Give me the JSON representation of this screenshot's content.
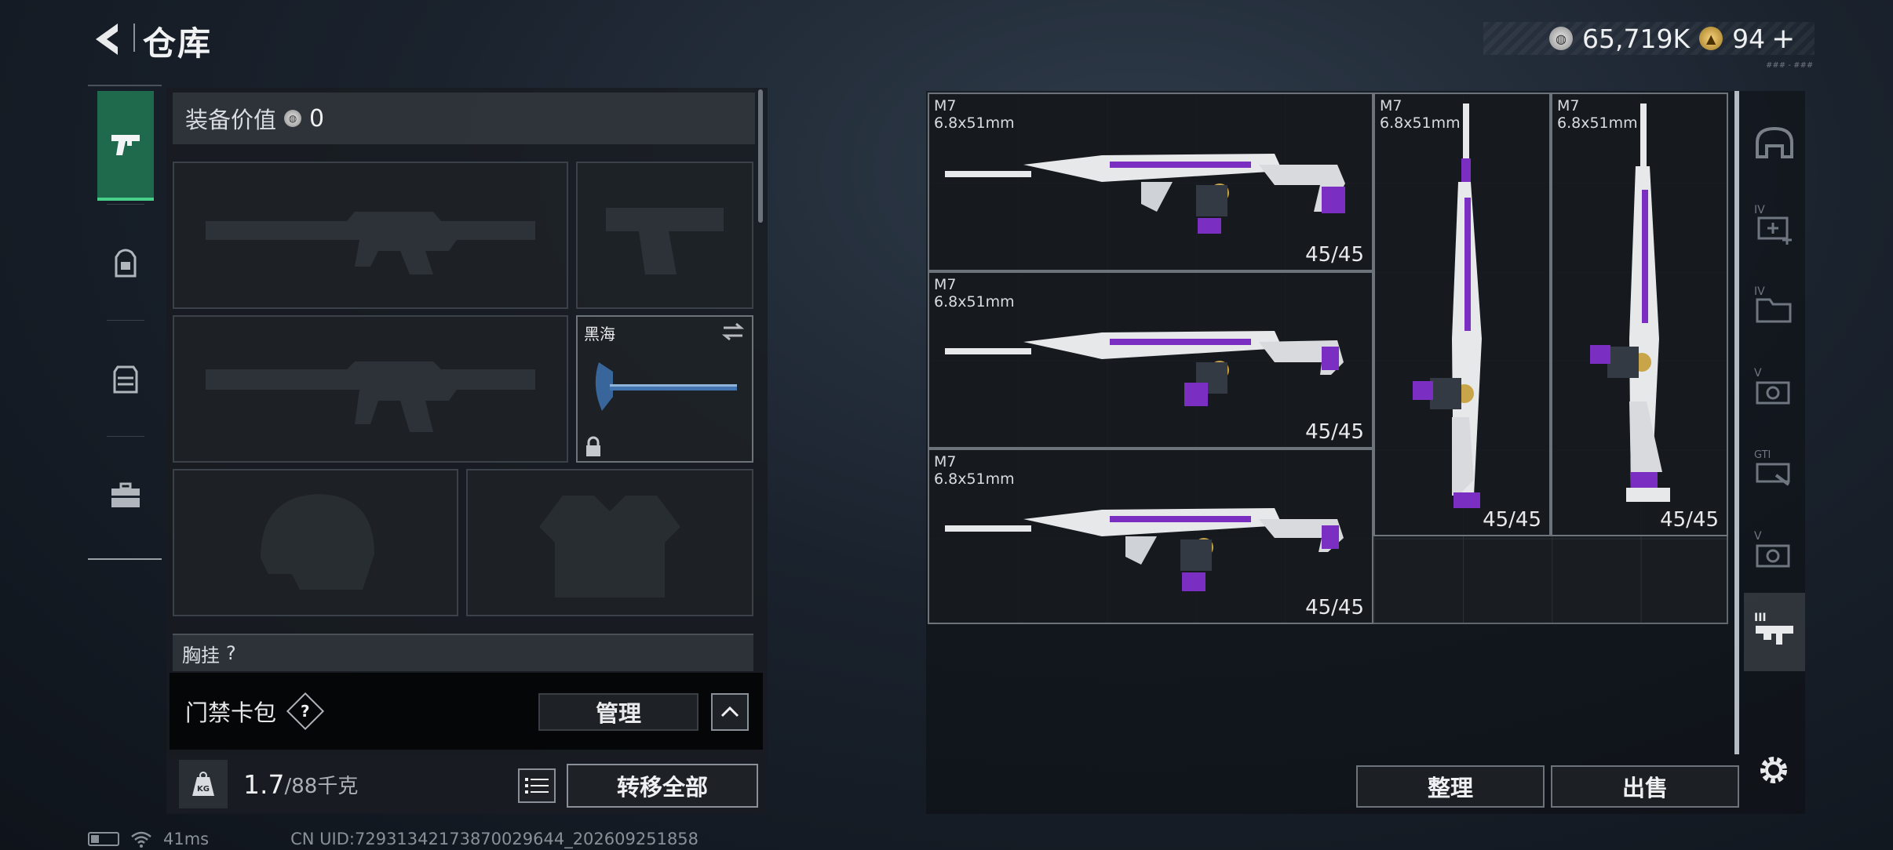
{
  "header": {
    "title": "仓库",
    "currency": {
      "silver": "65,719K",
      "gold": "94",
      "plus": "+"
    },
    "tiny_code": "### - ###"
  },
  "left_nav": {
    "items": [
      {
        "name": "weapons",
        "icon": "pistol-icon",
        "active": true
      },
      {
        "name": "backpack",
        "icon": "backpack-icon",
        "active": false
      },
      {
        "name": "vest",
        "icon": "vest-icon",
        "active": false
      },
      {
        "name": "case",
        "icon": "toolbox-icon",
        "active": false
      }
    ]
  },
  "equipment": {
    "value_label": "装备价值",
    "value": "0",
    "melee_label": "黑海",
    "vest_label": "胸挂",
    "vest_hint": "?"
  },
  "keycard": {
    "label": "门禁卡包",
    "help": "?",
    "manage_label": "管理"
  },
  "weight": {
    "current": "1.7",
    "max": "/88千克",
    "kg_icon": "KG",
    "transfer_all_label": "转移全部"
  },
  "status": {
    "ping": "41ms",
    "uid": "CN UID:72931342173870029644_202609251858"
  },
  "warehouse": {
    "weapons": [
      {
        "name": "M7",
        "caliber": "6.8x51mm",
        "ammo": "45/45"
      },
      {
        "name": "M7",
        "caliber": "6.8x51mm",
        "ammo": "45/45"
      },
      {
        "name": "M7",
        "caliber": "6.8x51mm",
        "ammo": "45/45"
      },
      {
        "name": "M7",
        "caliber": "6.8x51mm",
        "ammo": "45/45"
      },
      {
        "name": "M7",
        "caliber": "6.8x51mm",
        "ammo": "45/45"
      }
    ],
    "filters": [
      {
        "icon": "helmet-filter-icon",
        "badge": ""
      },
      {
        "icon": "medkit-filter-icon",
        "badge": "IV"
      },
      {
        "icon": "folder-filter-icon",
        "badge": "IV"
      },
      {
        "icon": "camera-filter-icon",
        "badge": "V"
      },
      {
        "icon": "cash-filter-icon",
        "badge": "GTI"
      },
      {
        "icon": "camera-filter-icon",
        "badge": "V"
      },
      {
        "icon": "weapon-filter-icon",
        "badge": "III"
      }
    ],
    "tidy_label": "整理",
    "sell_label": "出售"
  },
  "colors": {
    "accent_green": "#46d08a",
    "weapon_purple": "#7a2fc2",
    "weapon_white": "#e6e8ea",
    "weapon_gold": "#c9a54a"
  }
}
